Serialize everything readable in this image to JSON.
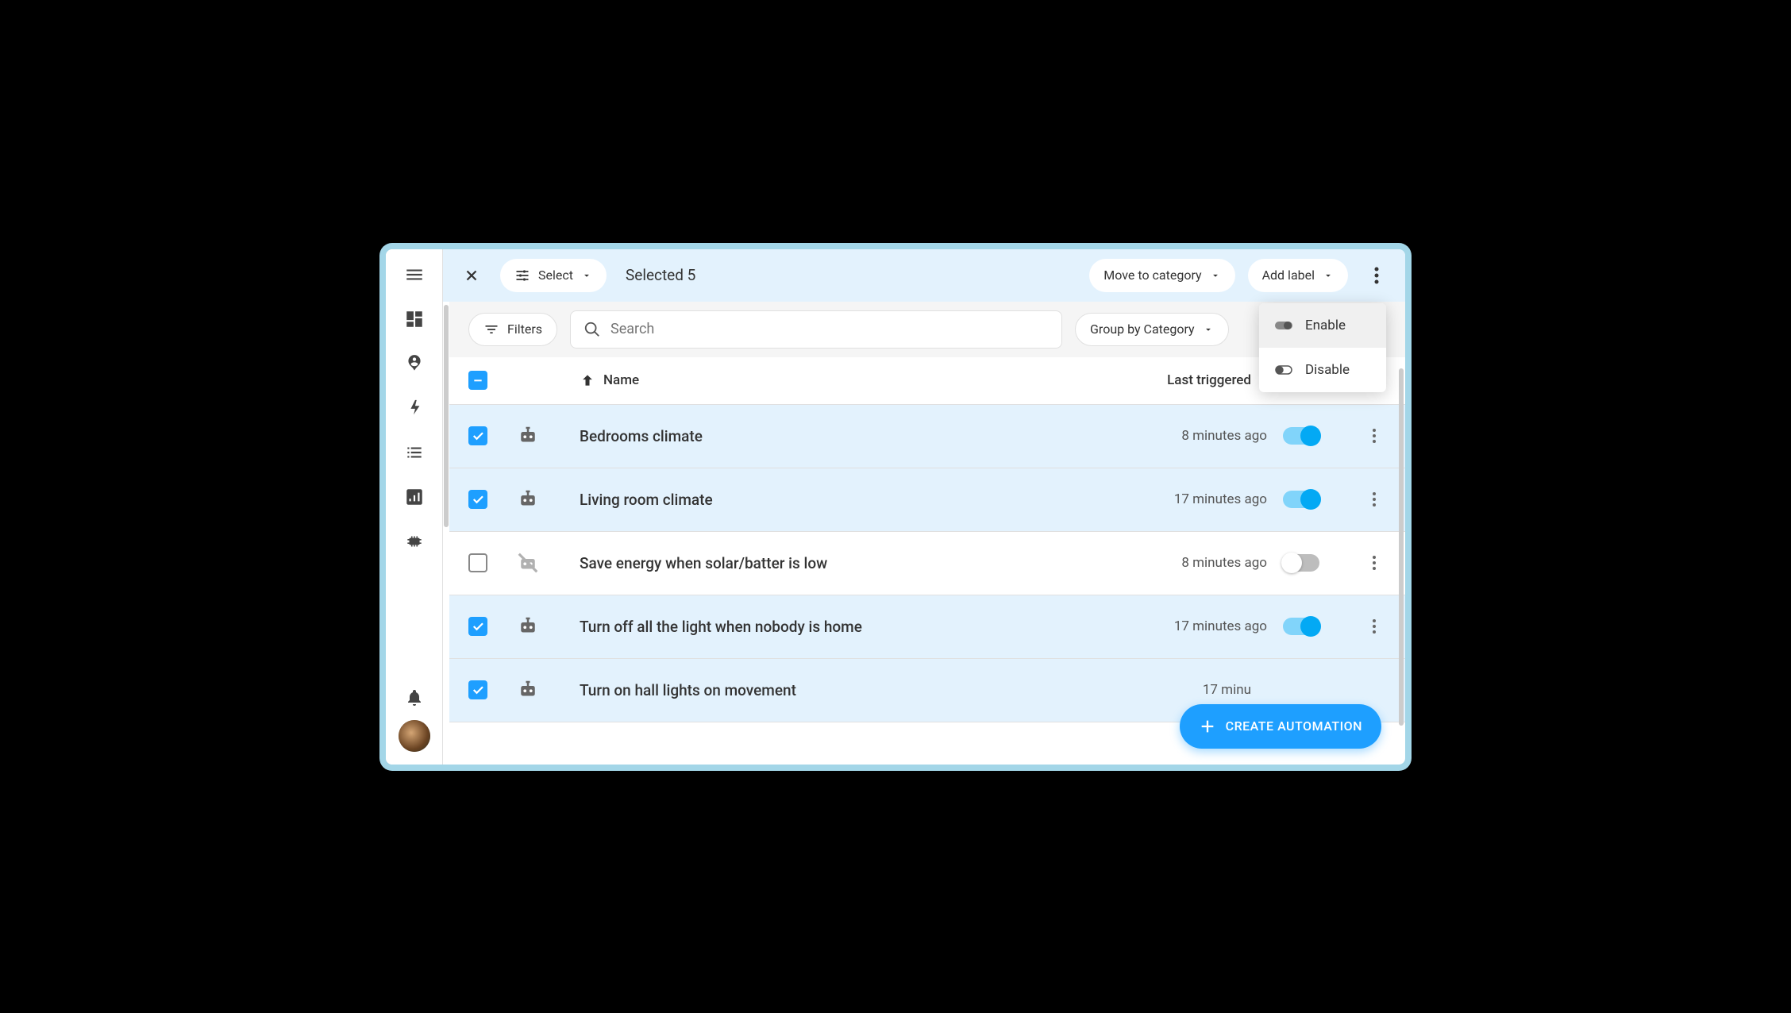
{
  "topbar": {
    "select_label": "Select",
    "selected_text": "Selected 5",
    "move_category_label": "Move to category",
    "add_label_label": "Add label"
  },
  "filterbar": {
    "filters_label": "Filters",
    "search_placeholder": "Search",
    "group_by_label": "Group by Category"
  },
  "table": {
    "header_name": "Name",
    "header_triggered": "Last triggered"
  },
  "rows": [
    {
      "name": "Bedrooms climate",
      "triggered": "8 minutes ago",
      "checked": true,
      "enabled": true
    },
    {
      "name": "Living room climate",
      "triggered": "17 minutes ago",
      "checked": true,
      "enabled": true
    },
    {
      "name": "Save energy when solar/batter is low",
      "triggered": "8 minutes ago",
      "checked": false,
      "enabled": false
    },
    {
      "name": "Turn off all the light when nobody is home",
      "triggered": "17 minutes ago",
      "checked": true,
      "enabled": true
    },
    {
      "name": "Turn on hall lights on movement",
      "triggered": "17 minu",
      "checked": true,
      "enabled": true
    }
  ],
  "popover": {
    "enable_label": "Enable",
    "disable_label": "Disable"
  },
  "fab": {
    "label": "CREATE AUTOMATION"
  }
}
